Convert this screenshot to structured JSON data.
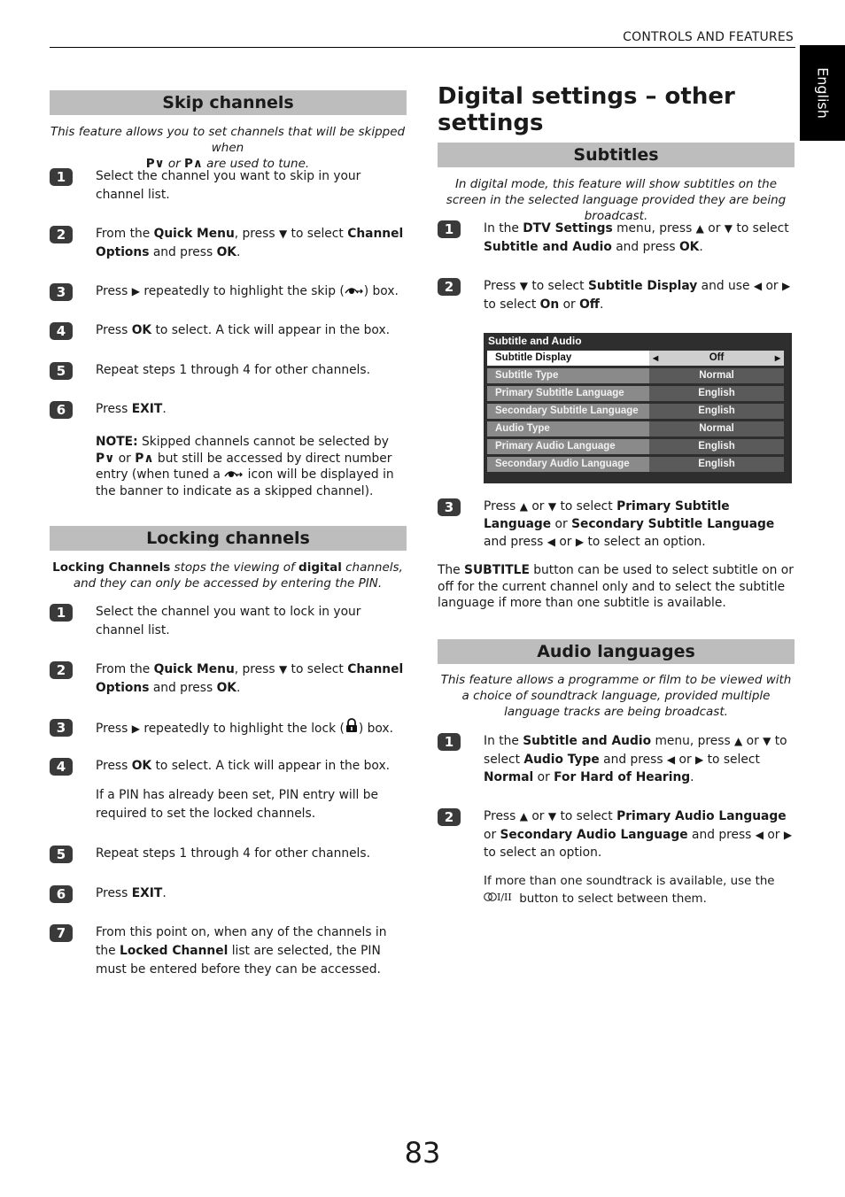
{
  "header": {
    "section_label": "CONTROLS AND FEATURES",
    "language_tab": "English"
  },
  "page_number": "83",
  "icons": {
    "down": "▼",
    "up": "▲",
    "left": "◀",
    "right": "▶",
    "p_down": "P⌄",
    "p_up": "P⌃",
    "skip": "👁→",
    "lock": "🔒",
    "dual_audio": "◯I/II"
  },
  "skip": {
    "title": "Skip channels",
    "intro_a": "This feature allows you to set channels that will be skipped when",
    "intro_p_down": "P∨",
    "intro_or": " or ",
    "intro_p_up": "P∧",
    "intro_b": " are used to tune.",
    "steps": [
      {
        "num": "1",
        "text": "Select the channel you want to skip in your channel list."
      },
      {
        "num": "2",
        "t1": "From the ",
        "b1": "Quick Menu",
        "t2": ", press ",
        "t3": " to select ",
        "b2": "Channel Options",
        "t4": " and press ",
        "b3": "OK",
        "t5": "."
      },
      {
        "num": "3",
        "t1": "Press ",
        "t2": " repeatedly to highlight the skip (",
        "t3": ") box."
      },
      {
        "num": "4",
        "t1": "Press ",
        "b1": "OK",
        "t2": " to select. A tick will appear in the box."
      },
      {
        "num": "5",
        "text": "Repeat steps 1 through 4 for other channels."
      },
      {
        "num": "6",
        "t1": "Press ",
        "b1": "EXIT",
        "t2": "."
      }
    ],
    "note": {
      "label": "NOTE:",
      "t1": " Skipped channels cannot be selected by ",
      "p_down": "P∨",
      "t2": " or ",
      "p_up": "P∧",
      "t3": " but still be accessed by direct number entry (when tuned a ",
      "t4": " icon will be displayed in the banner to indicate as a skipped channel)."
    }
  },
  "locking": {
    "title": "Locking channels",
    "intro_b1": "Locking Channels",
    "intro_t1": " stops the viewing of ",
    "intro_b2": "digital",
    "intro_t2": " channels, and they can only be accessed by entering the PIN.",
    "steps": [
      {
        "num": "1",
        "text": "Select the channel you want to lock in your channel list."
      },
      {
        "num": "2",
        "t1": "From the ",
        "b1": "Quick Menu",
        "t2": ", press ",
        "t3": " to select ",
        "b2": "Channel Options",
        "t4": " and press ",
        "b3": "OK",
        "t5": "."
      },
      {
        "num": "3",
        "t1": "Press ",
        "t2": " repeatedly to highlight the lock (",
        "t3": ") box."
      },
      {
        "num": "4",
        "t1": "Press ",
        "b1": "OK",
        "t2": " to select. A tick will appear in the box.",
        "sub": "If a PIN has already been set, PIN entry will be required to set the locked channels."
      },
      {
        "num": "5",
        "text": "Repeat steps 1 through 4 for other channels."
      },
      {
        "num": "6",
        "t1": "Press ",
        "b1": "EXIT",
        "t2": "."
      },
      {
        "num": "7",
        "t1": "From this point on, when any of the channels in the ",
        "b1": "Locked Channel",
        "t2": " list are selected, the PIN must be entered before they can be accessed."
      }
    ]
  },
  "digital": {
    "title": "Digital settings – other settings",
    "subtitles": {
      "title": "Subtitles",
      "intro": "In digital mode, this feature will show subtitles on the screen in the selected language provided they are being broadcast.",
      "steps": [
        {
          "num": "1",
          "t1": "In the ",
          "b1": "DTV Settings",
          "t2": " menu, press ",
          "t3": " or ",
          "t4": " to select ",
          "b2": "Subtitle and Audio",
          "t5": " and press ",
          "b3": "OK",
          "t6": "."
        },
        {
          "num": "2",
          "t1": "Press ",
          "t2": " to select ",
          "b1": "Subtitle Display",
          "t3": " and use ",
          "t4": " or ",
          "t5": " to select ",
          "b2": "On",
          "t6": " or ",
          "b3": "Off",
          "t7": "."
        },
        {
          "num": "3",
          "t1": "Press ",
          "t2": " or ",
          "t3": " to select ",
          "b1": "Primary Subtitle Language",
          "t4": " or ",
          "b2": "Secondary Subtitle Language",
          "t5": " and press ",
          "t6": " or ",
          "t7": " to select an option."
        }
      ],
      "para_t1": "The ",
      "para_b1": "SUBTITLE",
      "para_t2": " button can be used to select subtitle on or off for the current channel only and to select the subtitle language if more than one subtitle is available."
    },
    "menu": {
      "title": "Subtitle and Audio",
      "rows": [
        {
          "label": "Subtitle Display",
          "value": "Off",
          "selected": true
        },
        {
          "label": "Subtitle Type",
          "value": "Normal"
        },
        {
          "label": "Primary Subtitle Language",
          "value": "English"
        },
        {
          "label": "Secondary Subtitle Language",
          "value": "English"
        },
        {
          "label": "Audio Type",
          "value": "Normal"
        },
        {
          "label": "Primary Audio Language",
          "value": "English"
        },
        {
          "label": "Secondary Audio Language",
          "value": "English"
        }
      ]
    },
    "audio": {
      "title": "Audio languages",
      "intro": "This feature allows a programme or film to be viewed with a choice of soundtrack language, provided multiple language tracks are being broadcast.",
      "steps": [
        {
          "num": "1",
          "t1": "In the ",
          "b1": "Subtitle and Audio",
          "t2": " menu, press ",
          "t3": " or ",
          "t4": " to select ",
          "b2": "Audio Type",
          "t5": " and press ",
          "t6": " or ",
          "t7": " to select ",
          "b3": "Normal",
          "t8": " or ",
          "b4": "For Hard of Hearing",
          "t9": "."
        },
        {
          "num": "2",
          "t1": "Press ",
          "t2": " or ",
          "t3": " to select ",
          "b1": "Primary Audio Language",
          "t4": " or ",
          "b2": "Secondary Audio Language",
          "t5": " and press ",
          "t6": " or ",
          "t7": " to select an option.",
          "sub_t1": "If more than one soundtrack is available, use the ",
          "sub_t2": " button to select between them."
        }
      ]
    }
  }
}
